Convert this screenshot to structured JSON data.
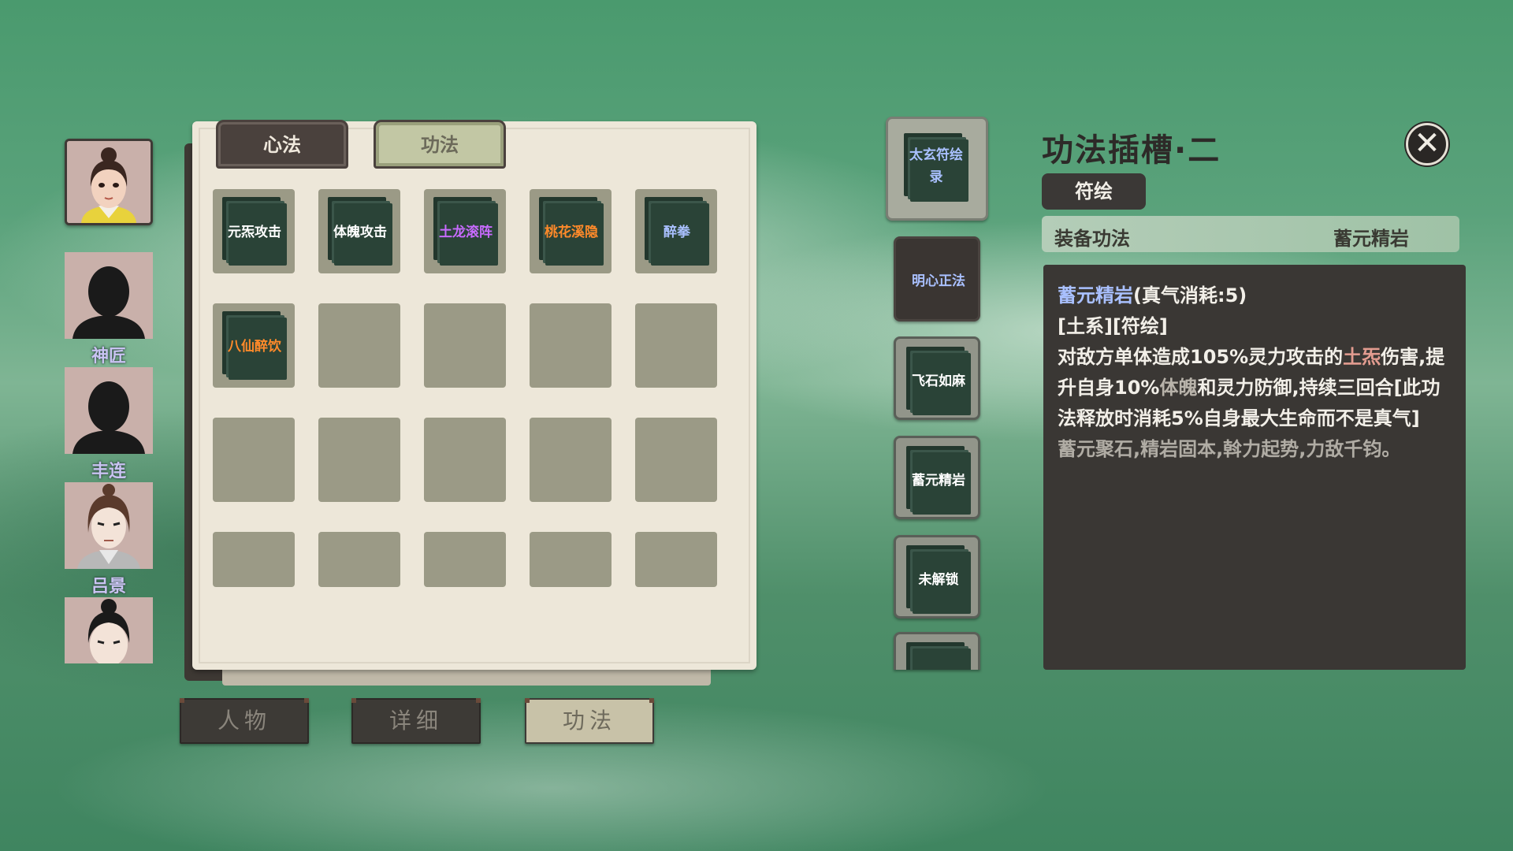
{
  "characters": [
    {
      "name": "",
      "selected": true,
      "type": "female-hair-bun"
    },
    {
      "name": "神匠",
      "selected": false,
      "type": "silhouette"
    },
    {
      "name": "丰连",
      "selected": false,
      "type": "silhouette"
    },
    {
      "name": "吕景",
      "selected": false,
      "type": "male-long-hair"
    },
    {
      "name": "",
      "selected": false,
      "type": "male-topknot"
    }
  ],
  "tabs": {
    "xinfa": "心法",
    "gongfa": "功法"
  },
  "inventory": [
    {
      "label": "元炁攻击",
      "color": "#ffffff"
    },
    {
      "label": "体魄攻击",
      "color": "#ffffff"
    },
    {
      "label": "土龙滚阵",
      "color": "#c86bff"
    },
    {
      "label": "桃花溪隐",
      "color": "#ff8a2a"
    },
    {
      "label": "醉拳",
      "color": "#a9c0ff"
    },
    {
      "label": "八仙醉饮",
      "color": "#ff8a2a"
    },
    null,
    null,
    null,
    null,
    null,
    null,
    null,
    null,
    null,
    null,
    null,
    null,
    null,
    null
  ],
  "skill_slots": [
    {
      "label_line1": "太玄符绘",
      "label_line2": "录",
      "color": "#a9c0ff",
      "style": "first"
    },
    {
      "label_line1": "明心正法",
      "label_line2": "",
      "color": "#a9c0ff",
      "style": "dark"
    },
    {
      "label_line1": "飞石如麻",
      "label_line2": "",
      "color": "#ffffff",
      "style": "normal"
    },
    {
      "label_line1": "蓄元精岩",
      "label_line2": "",
      "color": "#ffffff",
      "style": "normal"
    },
    {
      "label_line1": "未解锁",
      "label_line2": "",
      "color": "#ffffff",
      "style": "normal"
    }
  ],
  "detail": {
    "title": "功法插槽·二",
    "type_badge": "符绘",
    "equip_label": "装备功法",
    "equip_value": "蓄元精岩",
    "skill_name": "蓄元精岩",
    "cost": "(真气消耗:5)",
    "tags": "[土系][符绘]",
    "desc_a": "对敌方单体造成105%灵力攻击的",
    "desc_elem": "土炁",
    "desc_b": "伤害,提升自身10%",
    "desc_stat": "体魄",
    "desc_c": "和灵力防御,持续三回合[此功法释放时消耗5%自身最大生命而不是真气]",
    "flavor": "蓄元聚石,精岩固本,斡力起势,力敌千钧。"
  },
  "nav": [
    "人物",
    "详细",
    "功法"
  ],
  "nav_active": 2
}
